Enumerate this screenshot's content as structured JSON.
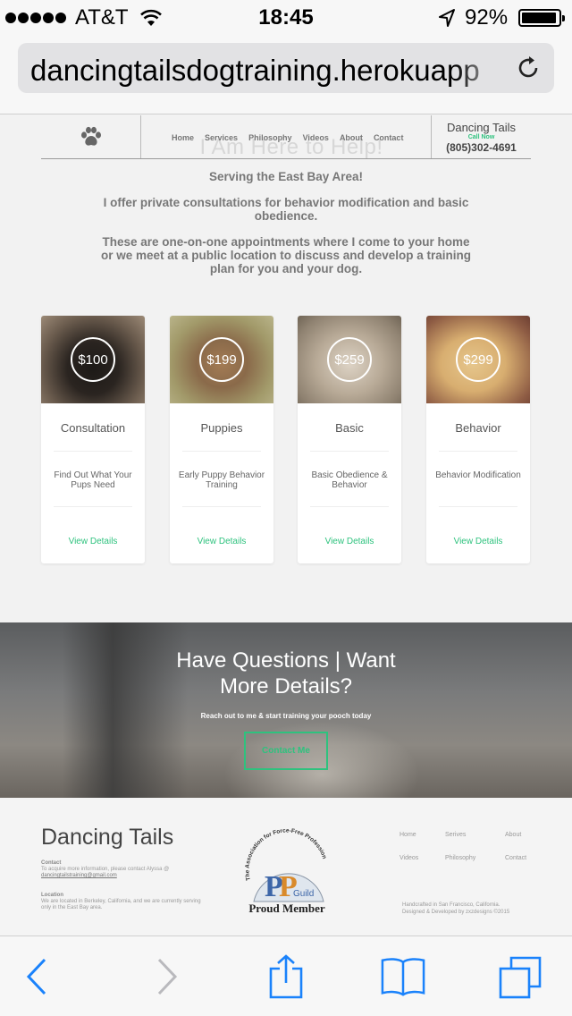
{
  "status_bar": {
    "carrier": "AT&T",
    "time": "18:45",
    "battery": "92%",
    "icons": [
      "signal-dots-icon",
      "wifi-icon",
      "location-arrow-icon",
      "battery-icon"
    ]
  },
  "address_bar": {
    "url": "dancingtailsdogtraining.herokuapp",
    "reload_icon": "reload-icon"
  },
  "site_header": {
    "logo_icon": "paw-icon",
    "nav": [
      "Home",
      "Services",
      "Philosophy",
      "Videos",
      "About",
      "Contact"
    ],
    "ghost_heading": "I Am Here to Help!",
    "brand": "Dancing Tails",
    "call_now": "Call Now",
    "phone": "(805)302-4691"
  },
  "intro": {
    "line1": "Serving the East Bay Area!",
    "line2": "I offer private consultations for behavior modification and basic obedience.",
    "line3": "These are one-on-one appointments where I come to your home or we meet at a public location to discuss and develop a training plan for you and your dog."
  },
  "cards": [
    {
      "price": "$100",
      "title": "Consultation",
      "desc": "Find Out What Your Pups Need",
      "link": "View Details"
    },
    {
      "price": "$199",
      "title": "Puppies",
      "desc": "Early Puppy Behavior Training",
      "link": "View Details"
    },
    {
      "price": "$259",
      "title": "Basic",
      "desc": "Basic Obedience & Behavior",
      "link": "View Details"
    },
    {
      "price": "$299",
      "title": "Behavior",
      "desc": "Behavior Modification",
      "link": "View Details"
    }
  ],
  "cta": {
    "heading": "Have Questions | Want More Details?",
    "sub": "Reach out to me & start training your pooch today",
    "button": "Contact Me"
  },
  "footer": {
    "brand": "Dancing Tails",
    "contact_label": "Contact",
    "contact_text": "To acquire more information, please contact Alyssa @",
    "contact_email": "dancingtailstraining@gmail.com",
    "location_label": "Location",
    "location_text": "We are located in Berkeley, California, and we are currently serving only in the East Bay area.",
    "badge_arc_text": "The Association for Force-Free Professionals",
    "badge_guild": "Guild",
    "badge_caption": "Proud Member",
    "nav": [
      "Home",
      "Serives",
      "About",
      "Videos",
      "Philosophy",
      "Contact"
    ],
    "credit_line1": "Handcrafted in San Francisco, California.",
    "credit_line2": "Designed & Developed by zxzdesigns ©2015"
  },
  "colors": {
    "accent_green": "#2ec27e",
    "ios_blue": "#1a82fb"
  },
  "toolbar": {
    "icons": [
      "back-icon",
      "forward-icon",
      "share-icon",
      "bookmarks-icon",
      "tabs-icon"
    ]
  }
}
